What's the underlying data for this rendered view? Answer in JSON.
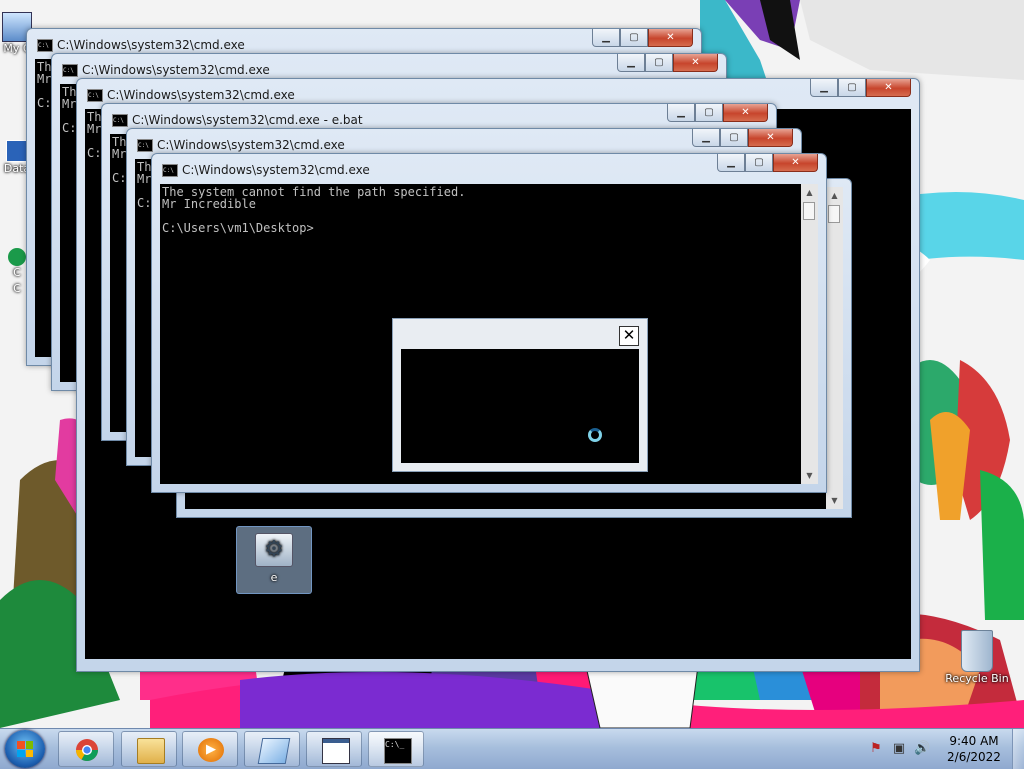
{
  "desktop": {
    "icons": [
      {
        "label": "My C"
      },
      {
        "label": "Data"
      },
      {
        "label": "C"
      },
      {
        "label": "C"
      },
      {
        "label": "e"
      },
      {
        "label": "Recycle Bin"
      }
    ]
  },
  "windows": [
    {
      "title": "C:\\Windows\\system32\\cmd.exe",
      "lines": [
        "Th",
        "Mr",
        "",
        "C:"
      ]
    },
    {
      "title": "C:\\Windows\\system32\\cmd.exe",
      "lines": [
        "Th",
        "Mr",
        "",
        "C:"
      ]
    },
    {
      "title": "C:\\Windows\\system32\\cmd.exe",
      "lines": [
        "Th",
        "Mr",
        "",
        "C:"
      ]
    },
    {
      "title": "C:\\Windows\\system32\\cmd.exe - e.bat",
      "lines": [
        "Th",
        "Mr",
        "",
        "C:"
      ]
    },
    {
      "title": "C:\\Windows\\system32\\cmd.exe",
      "lines": [
        "Th",
        "Mr",
        "",
        "C:"
      ]
    },
    {
      "title": "C:\\Windows\\system32\\cmd.exe",
      "lines": [
        "The system cannot find the path specified.",
        "Mr Incredible",
        "",
        "C:\\Users\\vm1\\Desktop>"
      ]
    }
  ],
  "window_buttons": {
    "minimize": "▁",
    "maximize": "▢",
    "close": "✕"
  },
  "dialog": {
    "close_label": "✕",
    "spinner_icon": "loading-spinner-icon"
  },
  "taskbar": {
    "pinned": [
      {
        "name": "chrome",
        "icon": "chrome-icon"
      },
      {
        "name": "explorer",
        "icon": "folder-icon"
      },
      {
        "name": "media-player",
        "icon": "media-player-icon"
      },
      {
        "name": "app-4",
        "icon": "window-app-icon"
      },
      {
        "name": "app-5",
        "icon": "document-window-icon"
      },
      {
        "name": "cmd",
        "icon": "command-prompt-icon"
      }
    ],
    "tray": {
      "flag": "⚑",
      "network": "▣",
      "volume": "🔊"
    },
    "clock": {
      "time": "9:40 AM",
      "date": "2/6/2022"
    }
  }
}
